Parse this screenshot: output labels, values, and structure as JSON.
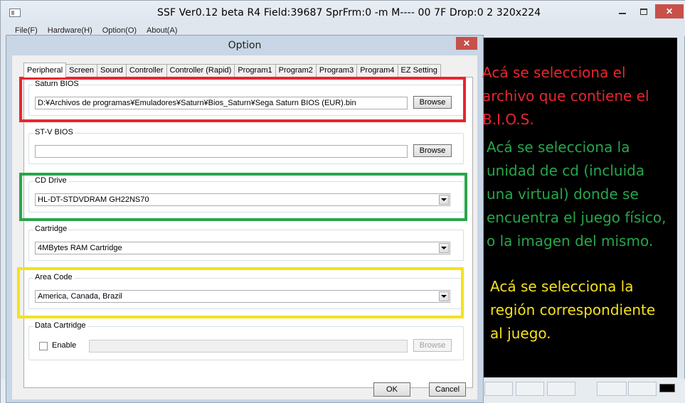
{
  "window": {
    "title": "SSF Ver0.12 beta R4  Field:39687  SprFrm:0  -m M----  00 7F  Drop:0  2  320x224",
    "close_glyph": "✕",
    "min_icon": "minimize-icon",
    "max_icon": "maximize-icon"
  },
  "menu": {
    "items": [
      "File(F)",
      "Hardware(H)",
      "Option(O)",
      "About(A)"
    ]
  },
  "dialog": {
    "title": "Option",
    "close_glyph": "✕",
    "tabs": [
      "Peripheral",
      "Screen",
      "Sound",
      "Controller",
      "Controller (Rapid)",
      "Program1",
      "Program2",
      "Program3",
      "Program4",
      "EZ Setting"
    ],
    "active_tab": "Peripheral",
    "saturn_bios": {
      "label": "Saturn BIOS",
      "path": "D:¥Archivos de programas¥Emuladores¥Saturn¥Bios_Saturn¥Sega Saturn BIOS (EUR).bin",
      "browse": "Browse"
    },
    "stv_bios": {
      "label": "ST-V BIOS",
      "path": "",
      "browse": "Browse"
    },
    "cd_drive": {
      "label": "CD Drive",
      "selected": "HL-DT-STDVDRAM GH22NS70"
    },
    "cartridge": {
      "label": "Cartridge",
      "selected": "4MBytes RAM Cartridge"
    },
    "area_code": {
      "label": "Area Code",
      "selected": "America, Canada, Brazil"
    },
    "data_cartridge": {
      "label": "Data Cartridge",
      "enable_label": "Enable",
      "enabled": false,
      "path": "",
      "browse": "Browse"
    },
    "ok": "OK",
    "cancel": "Cancel"
  },
  "annotations": {
    "red": {
      "color": "#e8262f",
      "lines": [
        "Acá se selecciona el",
        "archivo que contiene el",
        "B.I.O.S."
      ]
    },
    "green": {
      "color": "#27a64a",
      "lines": [
        "Acá se selecciona la",
        "unidad de cd (incluida",
        "una virtual) donde se",
        "encuentra el juego físico,",
        "o la imagen del mismo."
      ]
    },
    "yellow": {
      "color": "#f4e21a",
      "lines": [
        "Acá se selecciona la",
        "región correspondiente",
        "al juego."
      ]
    }
  }
}
